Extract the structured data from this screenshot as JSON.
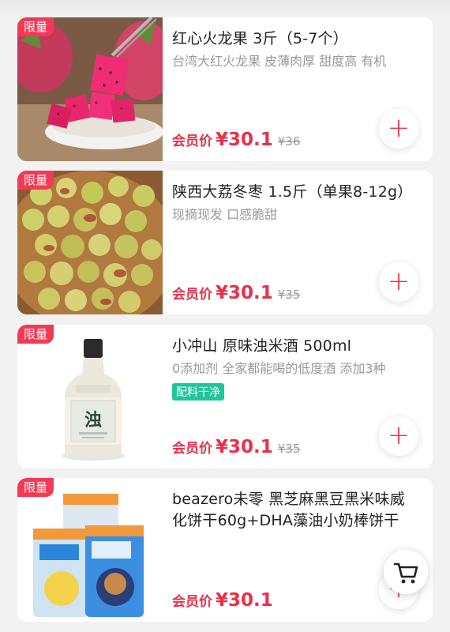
{
  "colors": {
    "accent": "#e8304a",
    "badge": "#f23a55",
    "tag_green": "#22c49a",
    "page_bg": "#f2f2f2"
  },
  "products": [
    {
      "badge": "限量",
      "title": "红心火龙果 3斤（5-7个）",
      "desc": "台湾大红火龙果 皮薄肉厚 甜度高 有机",
      "member_label": "会员价",
      "price": "¥30.1",
      "original_price": "¥36",
      "add_icon": "plus-icon"
    },
    {
      "badge": "限量",
      "title": "陕西大荔冬枣 1.5斤（单果8-12g）",
      "desc": "现摘现发 口感脆甜",
      "member_label": "会员价",
      "price": "¥30.1",
      "original_price": "¥35",
      "add_icon": "plus-icon"
    },
    {
      "badge": "限量",
      "title": "小冲山 原味浊米酒 500ml",
      "desc": "0添加剂 全家都能喝的低度酒 添加3种",
      "tag": "配料干净",
      "member_label": "会员价",
      "price": "¥30.1",
      "original_price": "¥35",
      "add_icon": "plus-icon",
      "bottle_label": "浊"
    },
    {
      "badge": "限量",
      "title": "beazero未零 黑芝麻黑豆黑米味威化饼干60g+DHA藻油小奶棒饼干",
      "member_label": "会员价",
      "price": "¥30.1",
      "add_icon": "plus-icon"
    }
  ],
  "cart": {
    "icon": "shopping-cart-icon"
  }
}
